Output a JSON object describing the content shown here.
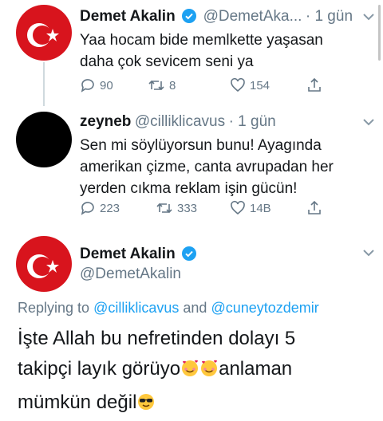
{
  "tweet1": {
    "display_name": "Demet Akalin",
    "handle": "@DemetAka...",
    "time": "· 1 gün",
    "text_line1": "Yaa hocam bide memlkette yaşasan",
    "text_line2": "daha çok sevicem seni ya",
    "replies": "90",
    "retweets": "8",
    "likes": "154"
  },
  "tweet2": {
    "display_name": "zeyneb",
    "handle": "@cilliklicavus",
    "time": "· 1 gün",
    "text_line1": "Sen mi söylüyorsun bunu! Ayagında",
    "text_line2": "amerikan çizme, canta avrupadan her",
    "text_line3": "yerden cıkma reklam işin gücün!",
    "replies": "223",
    "retweets": "333",
    "likes": "14B"
  },
  "tweet3": {
    "display_name": "Demet Akalin",
    "handle": "@DemetAkalin",
    "replying_prefix": "Replying to",
    "reply_user1": "@cilliklicavus",
    "reply_and": "and",
    "reply_user2": "@cuneytozdemir",
    "text_line1": "İşte Allah bu nefretinden dolayı 5",
    "text_line2a": "takipçi layık görüyo",
    "text_line2b": "anlaman",
    "text_line3": "mümkün değil"
  },
  "colors": {
    "accent": "#1da1f2",
    "muted": "#657786",
    "avatar_red": "#d8141d"
  }
}
